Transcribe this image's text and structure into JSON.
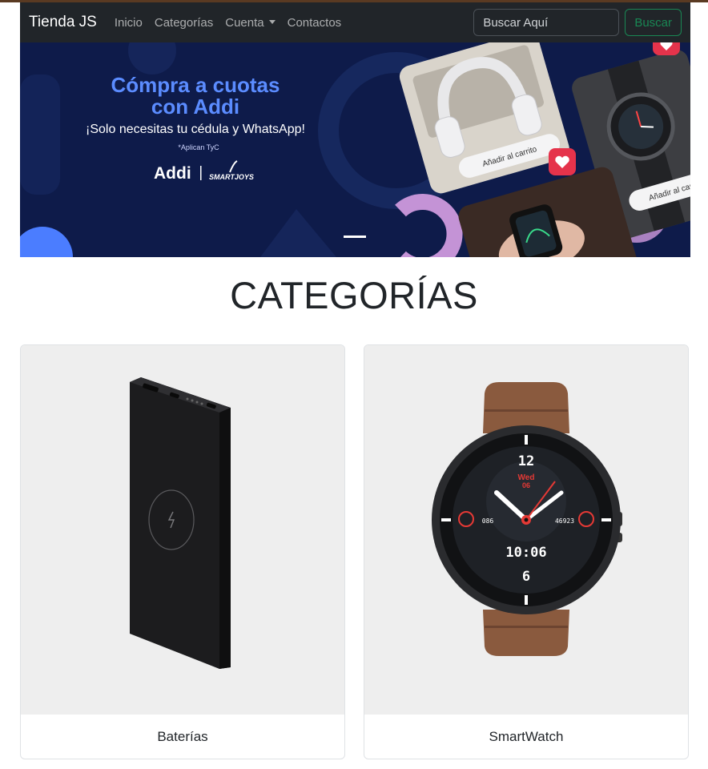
{
  "navbar": {
    "brand": "Tienda JS",
    "links": [
      "Inicio",
      "Categorías",
      "Cuenta",
      "Contactos"
    ],
    "search_placeholder": "Buscar Aquí",
    "search_button": "Buscar"
  },
  "banner": {
    "headline_line1": "Cómpra a cuotas",
    "headline_line2": "con Addi",
    "subline": "¡Solo necesitas tu cédula y WhatsApp!",
    "terms": "*Aplican TyC",
    "brand_addi": "Addi",
    "brand_partner": "SMARTJOYS",
    "add_to_cart_1": "Añadir al carrito",
    "add_to_cart_2": "Añadir al carrito",
    "colors": {
      "background": "#0e1b4a",
      "headline": "#5b8cff",
      "accent": "#c493d6"
    }
  },
  "section": {
    "title": "CATEGORÍAS"
  },
  "categories": [
    {
      "name": "Baterías",
      "icon": "power-bank-image"
    },
    {
      "name": "SmartWatch",
      "icon": "smartwatch-image",
      "face": {
        "top": "12",
        "day": "Wed",
        "date": "06",
        "left_stat": "086",
        "right_stat": "46923",
        "time": "10:06",
        "bottom": "6"
      }
    }
  ]
}
